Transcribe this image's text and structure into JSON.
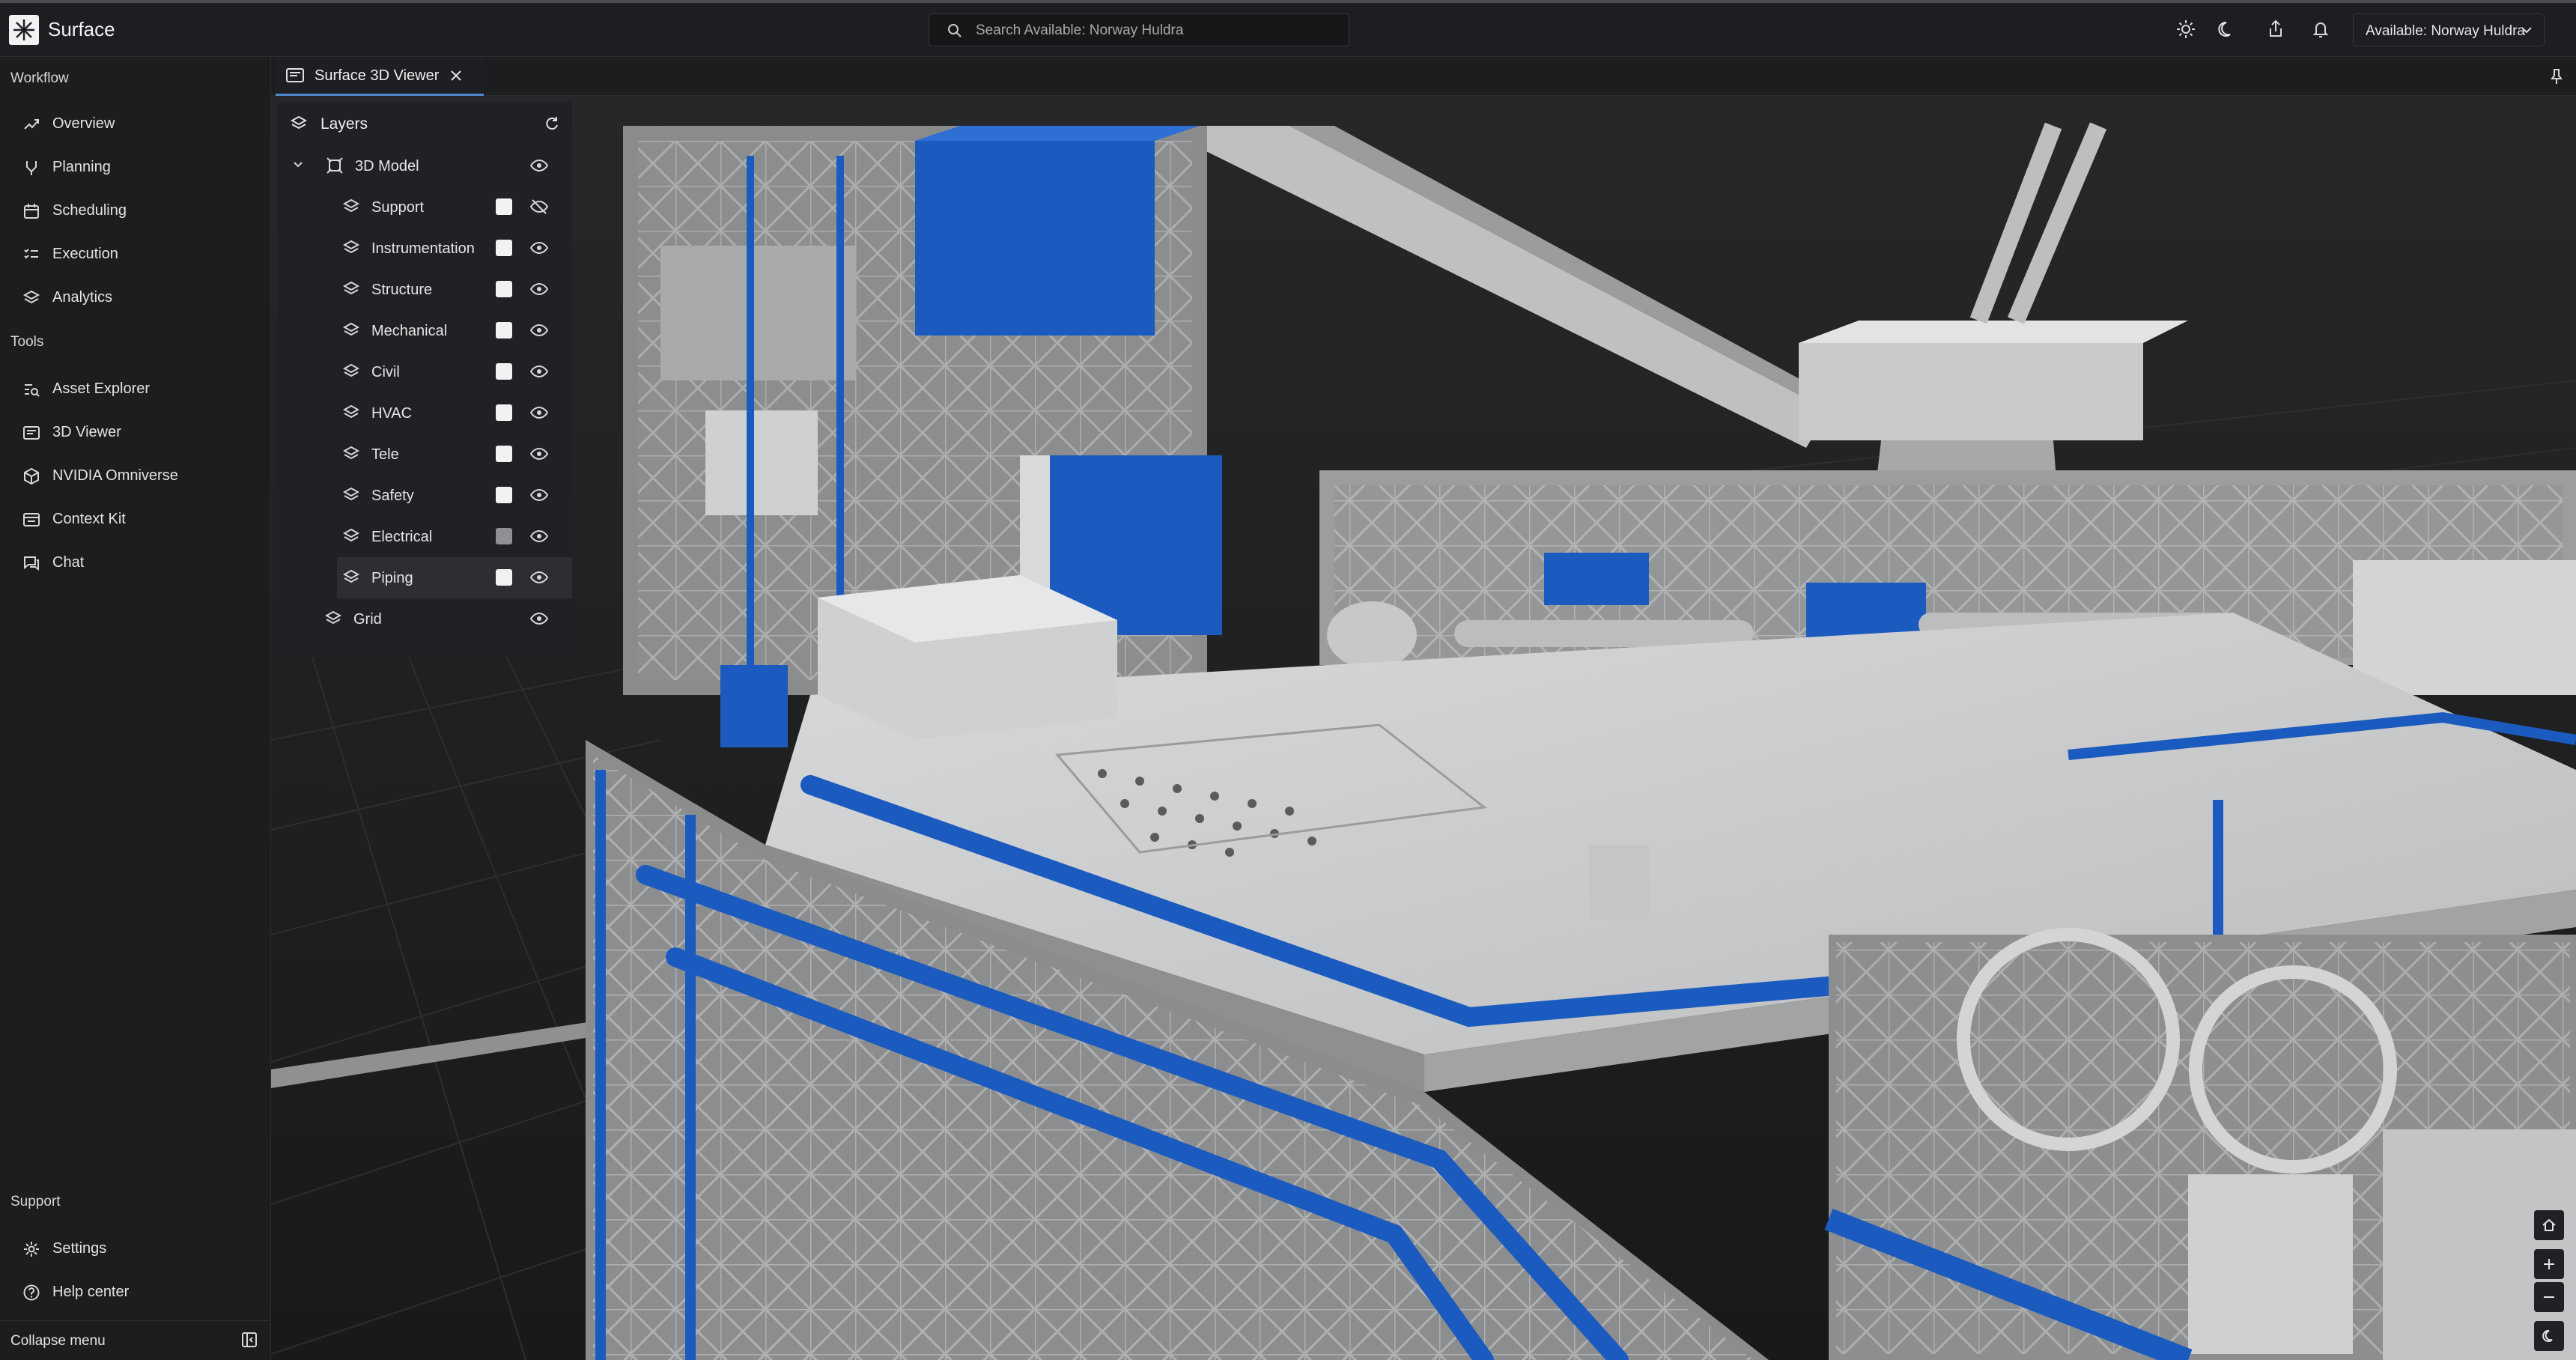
{
  "app": {
    "name": "Surface"
  },
  "search": {
    "placeholder": "Search Available: Norway Huldra"
  },
  "header": {
    "theme_light_icon": "sun-icon",
    "theme_dark_icon": "moon-icon",
    "share_icon": "share-icon",
    "notification_icon": "bell-icon",
    "asset_selector": "Available: Norway Huldra"
  },
  "sidebar": {
    "workflow_heading": "Workflow",
    "workflow": [
      {
        "label": "Overview",
        "icon": "trend-icon"
      },
      {
        "label": "Planning",
        "icon": "branch-icon"
      },
      {
        "label": "Scheduling",
        "icon": "calendar-icon"
      },
      {
        "label": "Execution",
        "icon": "checklist-icon"
      },
      {
        "label": "Analytics",
        "icon": "layers-icon"
      }
    ],
    "tools_heading": "Tools",
    "tools": [
      {
        "label": "Asset Explorer",
        "icon": "list-search-icon"
      },
      {
        "label": "3D Viewer",
        "icon": "viewer-icon"
      },
      {
        "label": "NVIDIA Omniverse",
        "icon": "cube-icon"
      },
      {
        "label": "Context Kit",
        "icon": "window-icon"
      },
      {
        "label": "Chat",
        "icon": "chat-icon"
      }
    ],
    "support_heading": "Support",
    "support": [
      {
        "label": "Settings",
        "icon": "gear-icon"
      },
      {
        "label": "Help center",
        "icon": "help-icon"
      }
    ],
    "collapse_label": "Collapse menu"
  },
  "tab": {
    "label": "Surface 3D Viewer"
  },
  "layers": {
    "title": "Layers",
    "root": {
      "label": "3D Model",
      "expanded": true,
      "visible": true
    },
    "children": [
      {
        "label": "Support",
        "checked": true,
        "visible": false
      },
      {
        "label": "Instrumentation",
        "checked": true,
        "visible": true
      },
      {
        "label": "Structure",
        "checked": true,
        "visible": true
      },
      {
        "label": "Mechanical",
        "checked": true,
        "visible": true
      },
      {
        "label": "Civil",
        "checked": true,
        "visible": true
      },
      {
        "label": "HVAC",
        "checked": true,
        "visible": true
      },
      {
        "label": "Tele",
        "checked": true,
        "visible": true
      },
      {
        "label": "Safety",
        "checked": true,
        "visible": true
      },
      {
        "label": "Electrical",
        "checked": false,
        "visible": true
      },
      {
        "label": "Piping",
        "checked": true,
        "visible": true,
        "selected": true
      }
    ],
    "grid": {
      "label": "Grid",
      "visible": true
    }
  },
  "colors": {
    "accent": "#4e86c9",
    "model_blue": "#1b5bbf",
    "model_grey": "#c9cacc",
    "background": "#1c1d1f"
  }
}
